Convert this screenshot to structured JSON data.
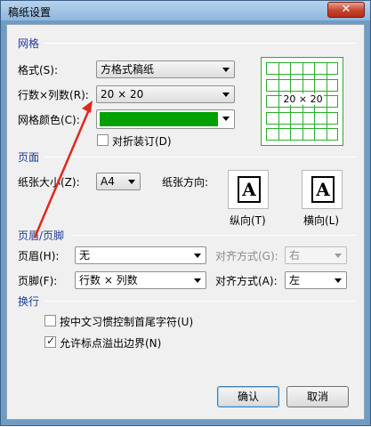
{
  "window": {
    "title": "稿纸设置",
    "close_label": "✕"
  },
  "grid_section": {
    "title": "网格",
    "format_label": "格式(S):",
    "format_value": "方格式稿纸",
    "rows_cols_label": "行数×列数(R):",
    "rows_cols_value": "20 × 20",
    "color_label": "网格颜色(C):",
    "color_value": "#00a000",
    "fold_label": "对折装订(D)",
    "fold_checked": false,
    "preview_text": "20 × 20",
    "preview_color": "#2bac2b"
  },
  "page_section": {
    "title": "页面",
    "paper_size_label": "纸张大小(Z):",
    "paper_size_value": "A4",
    "orientation_label": "纸张方向:",
    "portrait_label": "纵向(T)",
    "landscape_label": "横向(L)",
    "page_letter": "A"
  },
  "header_section": {
    "title": "页眉/页脚",
    "header_label": "页眉(H):",
    "header_value": "无",
    "header_align_label": "对齐方式(G):",
    "header_align_value": "右",
    "footer_label": "页脚(F):",
    "footer_value": "行数 × 列数",
    "footer_align_label": "对齐方式(A):",
    "footer_align_value": "左"
  },
  "wrap_section": {
    "title": "换行",
    "option1_label": "按中文习惯控制首尾字符(U)",
    "option1_checked": false,
    "option2_label": "允许标点溢出边界(N)",
    "option2_checked": true
  },
  "buttons": {
    "ok": "确认",
    "cancel": "取消"
  },
  "annotation_color": "#e0281e"
}
